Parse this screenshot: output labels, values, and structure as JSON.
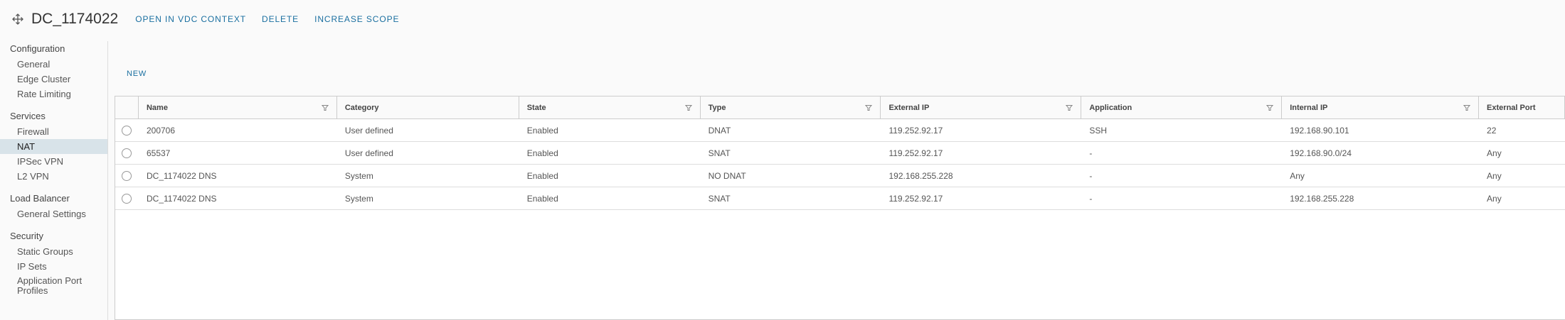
{
  "header": {
    "title": "DC_1174022",
    "actions": [
      "OPEN IN VDC CONTEXT",
      "DELETE",
      "INCREASE SCOPE"
    ]
  },
  "sidebar": {
    "sections": [
      {
        "title": "Configuration",
        "items": [
          "General",
          "Edge Cluster",
          "Rate Limiting"
        ]
      },
      {
        "title": "Services",
        "items": [
          "Firewall",
          "NAT",
          "IPSec VPN",
          "L2 VPN"
        ]
      },
      {
        "title": "Load Balancer",
        "items": [
          "General Settings"
        ]
      },
      {
        "title": "Security",
        "items": [
          "Static Groups",
          "IP Sets",
          "Application Port Profiles"
        ]
      }
    ],
    "active": "NAT"
  },
  "toolbar": {
    "new_label": "NEW"
  },
  "table": {
    "columns": [
      "Name",
      "Category",
      "State",
      "Type",
      "External IP",
      "Application",
      "Internal IP",
      "External Port"
    ],
    "rows": [
      [
        "200706",
        "User defined",
        "Enabled",
        "DNAT",
        "119.252.92.17",
        "SSH",
        "192.168.90.101",
        "22"
      ],
      [
        "65537",
        "User defined",
        "Enabled",
        "SNAT",
        "119.252.92.17",
        "-",
        "192.168.90.0/24",
        "Any"
      ],
      [
        "DC_1174022 DNS",
        "System",
        "Enabled",
        "NO DNAT",
        "192.168.255.228",
        "-",
        "Any",
        "Any"
      ],
      [
        "DC_1174022 DNS",
        "System",
        "Enabled",
        "SNAT",
        "119.252.92.17",
        "-",
        "192.168.255.228",
        "Any"
      ]
    ]
  },
  "icons": {
    "title_icon": "move-arrows-icon",
    "filter_icon": "filter-icon",
    "accent_color": "#1a6fa0"
  }
}
